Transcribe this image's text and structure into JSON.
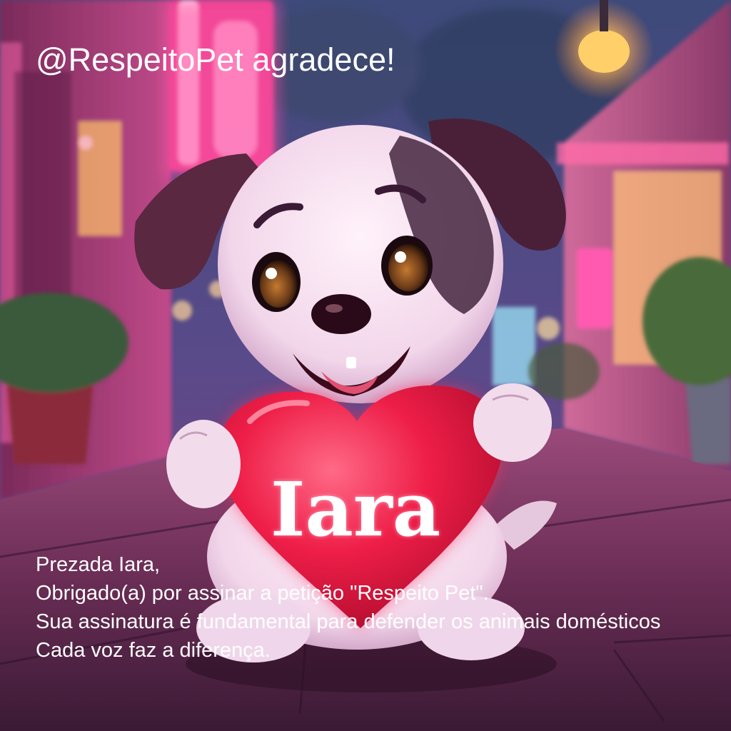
{
  "header": {
    "title": "@RespeitoPet agradece!"
  },
  "heart": {
    "name": "Iara"
  },
  "message": {
    "line1": "Prezada Iara,",
    "line2": "Obrigado(a) por assinar a petição \"Respeito Pet\".",
    "line3": "Sua assinatura é fundamental para defender os animais domésticos",
    "line4": "Cada voz faz a diferença."
  },
  "colors": {
    "heart": "#e8173f",
    "neon_pink": "#ff4fa3",
    "text": "#ffffff"
  },
  "icons": {
    "main_figure": "cartoon-puppy-holding-heart"
  }
}
